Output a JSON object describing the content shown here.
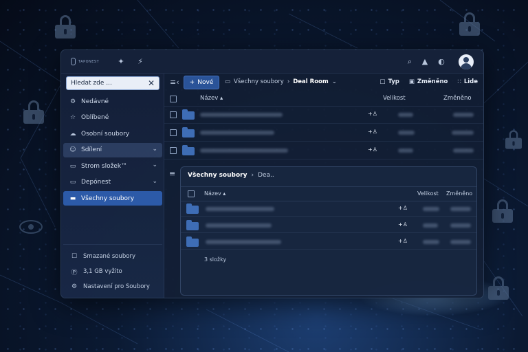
{
  "app": {
    "logo_text": "TAPONEST"
  },
  "sidebar": {
    "search": {
      "value": "Hledat zde ..."
    },
    "items": [
      {
        "label": "Nedávné",
        "icon": "gear-icon"
      },
      {
        "label": "Oblíbené",
        "icon": "star-icon"
      },
      {
        "label": "Osobní soubory",
        "icon": "cloud-icon"
      },
      {
        "label": "Sdílení",
        "icon": "share-icon"
      },
      {
        "label": "Strom složek™",
        "icon": "folder-icon"
      },
      {
        "label": "Depónest",
        "icon": "folder-icon"
      },
      {
        "label": "Všechny soubory",
        "icon": "folder-icon"
      }
    ],
    "footer": [
      {
        "label": "Smazané soubory",
        "icon": "trash-icon"
      },
      {
        "label": "3,1 GB vyžito",
        "icon": "storage-icon"
      },
      {
        "label": "Nastavení pro Soubory",
        "icon": "gear-icon"
      }
    ]
  },
  "toolbar": {
    "new_label": "Nové",
    "breadcrumb_root": "Všechny soubory",
    "breadcrumb_current": "Deal Room",
    "type_label": "Typ",
    "modified_label": "Změněno",
    "people_label": "Lide"
  },
  "table": {
    "col_name": "Název",
    "col_size": "Velikost",
    "col_modified": "Změněno"
  },
  "panel": {
    "breadcrumb_root": "Všechny soubory",
    "breadcrumb_current": "Dea..",
    "col_name": "Název",
    "col_size": "Velikost",
    "col_modified": "Změněno",
    "summary": "3 složky"
  },
  "colors": {
    "accent": "#2c5aa8",
    "folder": "#3e6db5",
    "background": "#0b1a33"
  }
}
